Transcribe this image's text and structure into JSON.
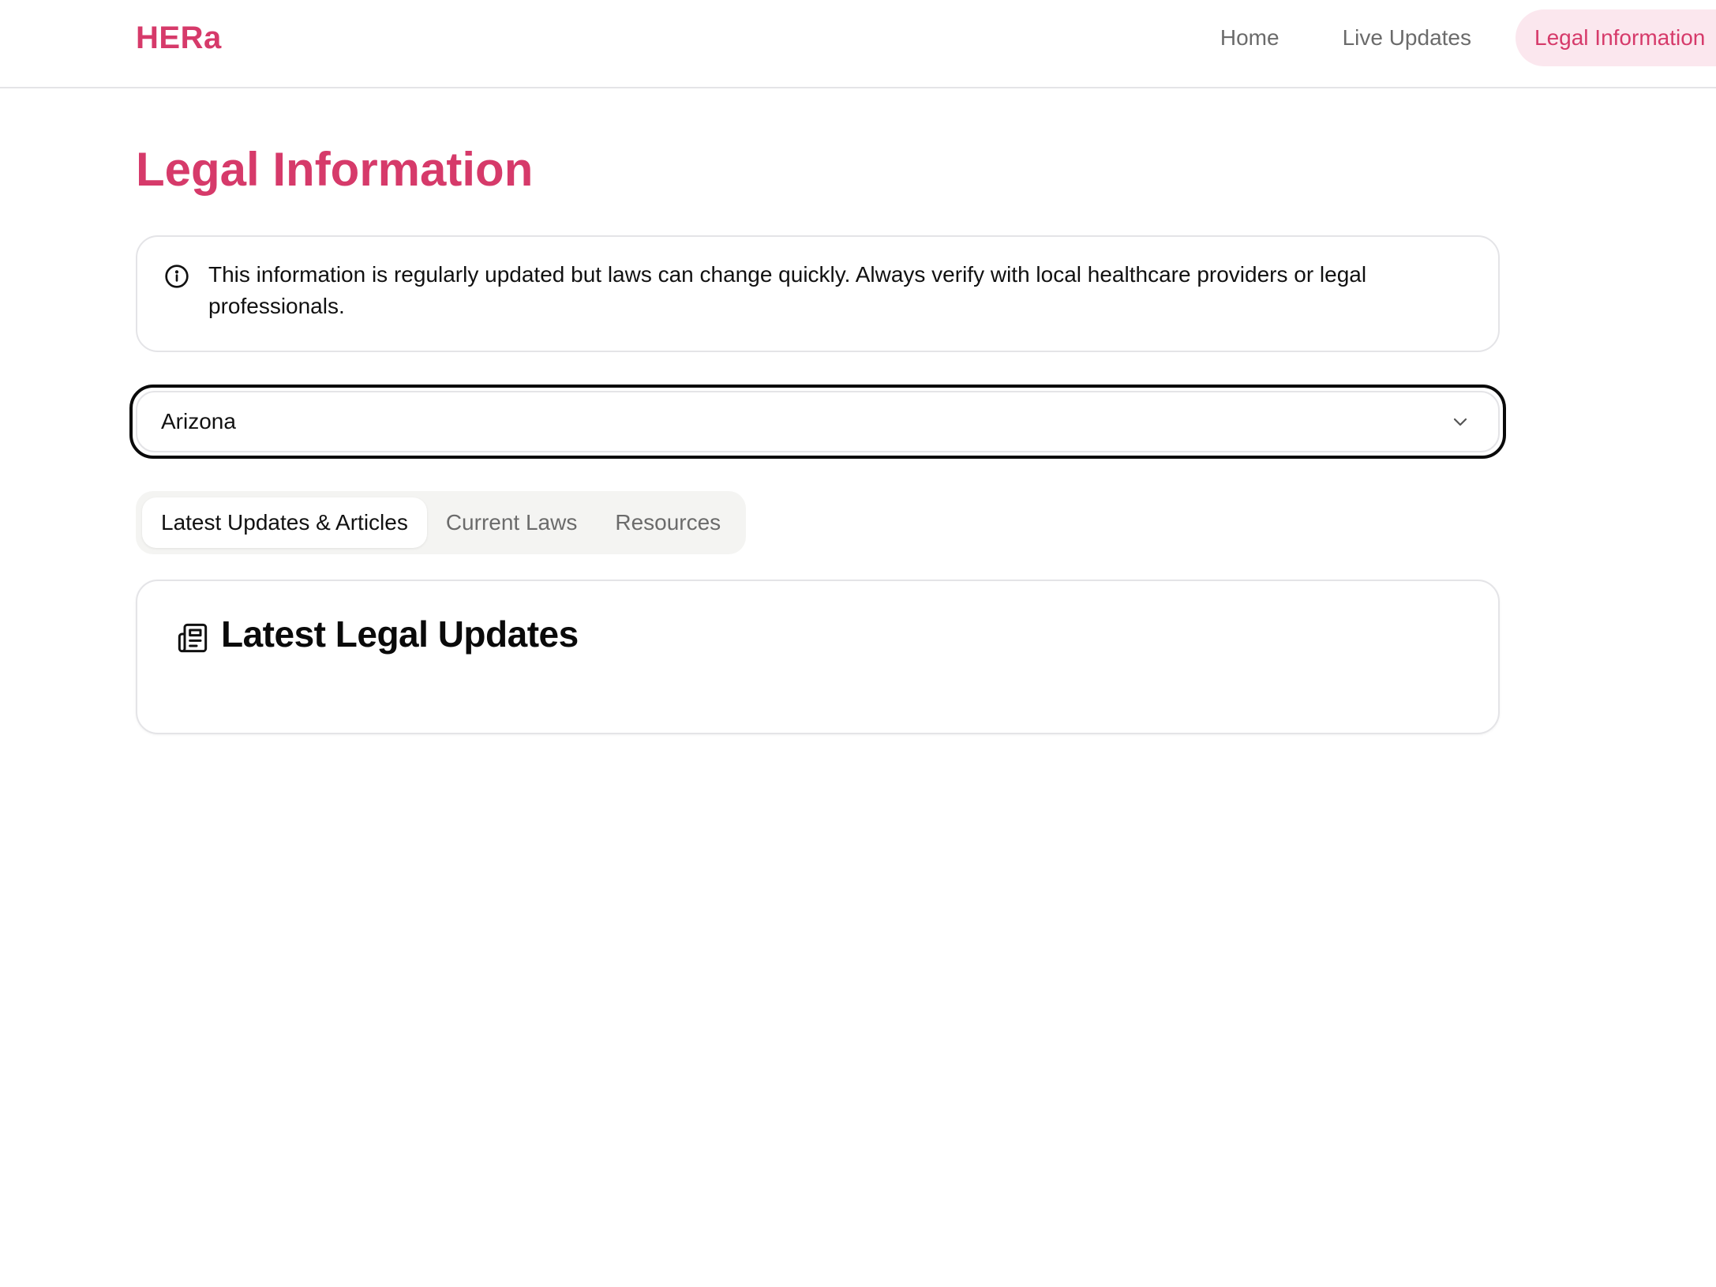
{
  "brand": {
    "name": "HERa",
    "color": "#d63a6a"
  },
  "nav": {
    "items": [
      {
        "label": "Home",
        "active": false
      },
      {
        "label": "Live Updates",
        "active": false
      },
      {
        "label": "Legal Information",
        "active": true
      }
    ]
  },
  "page": {
    "title": "Legal Information"
  },
  "notice": {
    "icon": "info-icon",
    "text": "This information is regularly updated but laws can change quickly. Always verify with local healthcare providers or legal professionals."
  },
  "state_select": {
    "value": "Arizona",
    "icon": "chevron-down-icon"
  },
  "tabs": [
    {
      "label": "Latest Updates & Articles",
      "active": true
    },
    {
      "label": "Current Laws",
      "active": false
    },
    {
      "label": "Resources",
      "active": false
    }
  ],
  "card": {
    "icon": "newspaper-icon",
    "title": "Latest Legal Updates"
  },
  "colors": {
    "accent": "#d63a6a",
    "accent_bg": "#fbe7ee",
    "border": "#e4e4e7",
    "tab_bg": "#f4f4f2"
  }
}
